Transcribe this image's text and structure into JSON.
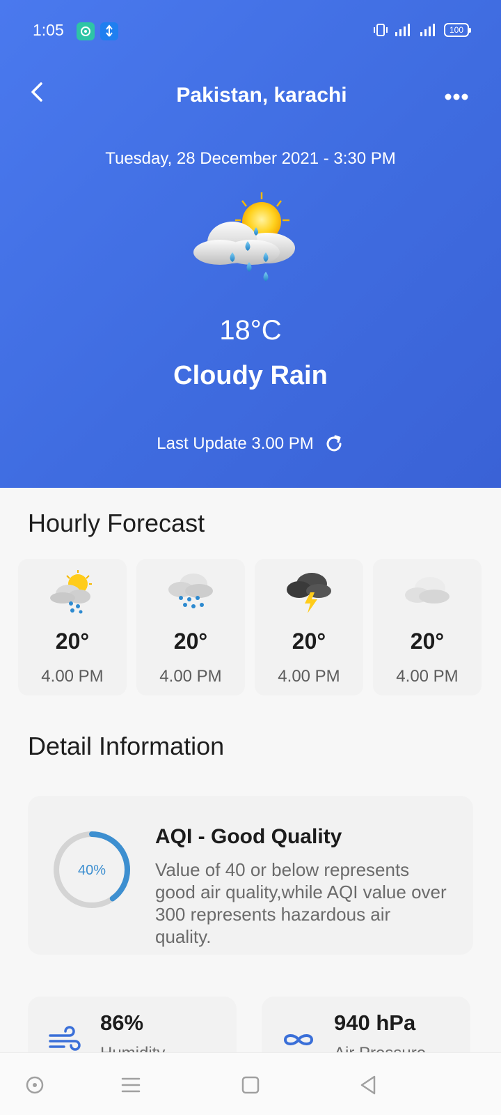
{
  "status_bar": {
    "time": "1:05",
    "battery": "100"
  },
  "header": {
    "location": "Pakistan, karachi",
    "date": "Tuesday, 28 December 2021 - 3:30 PM",
    "temperature": "18°C",
    "condition": "Cloudy Rain",
    "last_update": "Last Update 3.00 PM"
  },
  "hourly": {
    "title": "Hourly Forecast",
    "items": [
      {
        "icon": "sun-cloud-rain-icon",
        "temp": "20°",
        "time": "4.00 PM"
      },
      {
        "icon": "cloud-rain-icon",
        "temp": "20°",
        "time": "4.00 PM"
      },
      {
        "icon": "thunderstorm-icon",
        "temp": "20°",
        "time": "4.00 PM"
      },
      {
        "icon": "cloud-icon",
        "temp": "20°",
        "time": "4.00 PM"
      }
    ]
  },
  "details": {
    "title": "Detail Information",
    "aqi": {
      "value_label": "40%",
      "progress": 0.4,
      "title": "AQI - Good Quality",
      "description": "Value of 40 or below represents good air quality,while AQI value over 300 represents hazardous air quality."
    },
    "stats": [
      {
        "icon": "wind-icon",
        "value": "86%",
        "label": "Humidity"
      },
      {
        "icon": "pressure-icon",
        "value": "940 hPa",
        "label": "Air Pressure"
      }
    ]
  },
  "colors": {
    "primary": "#4375e6",
    "accent": "#3d8fd0",
    "ring_track": "#d4d4d4"
  }
}
